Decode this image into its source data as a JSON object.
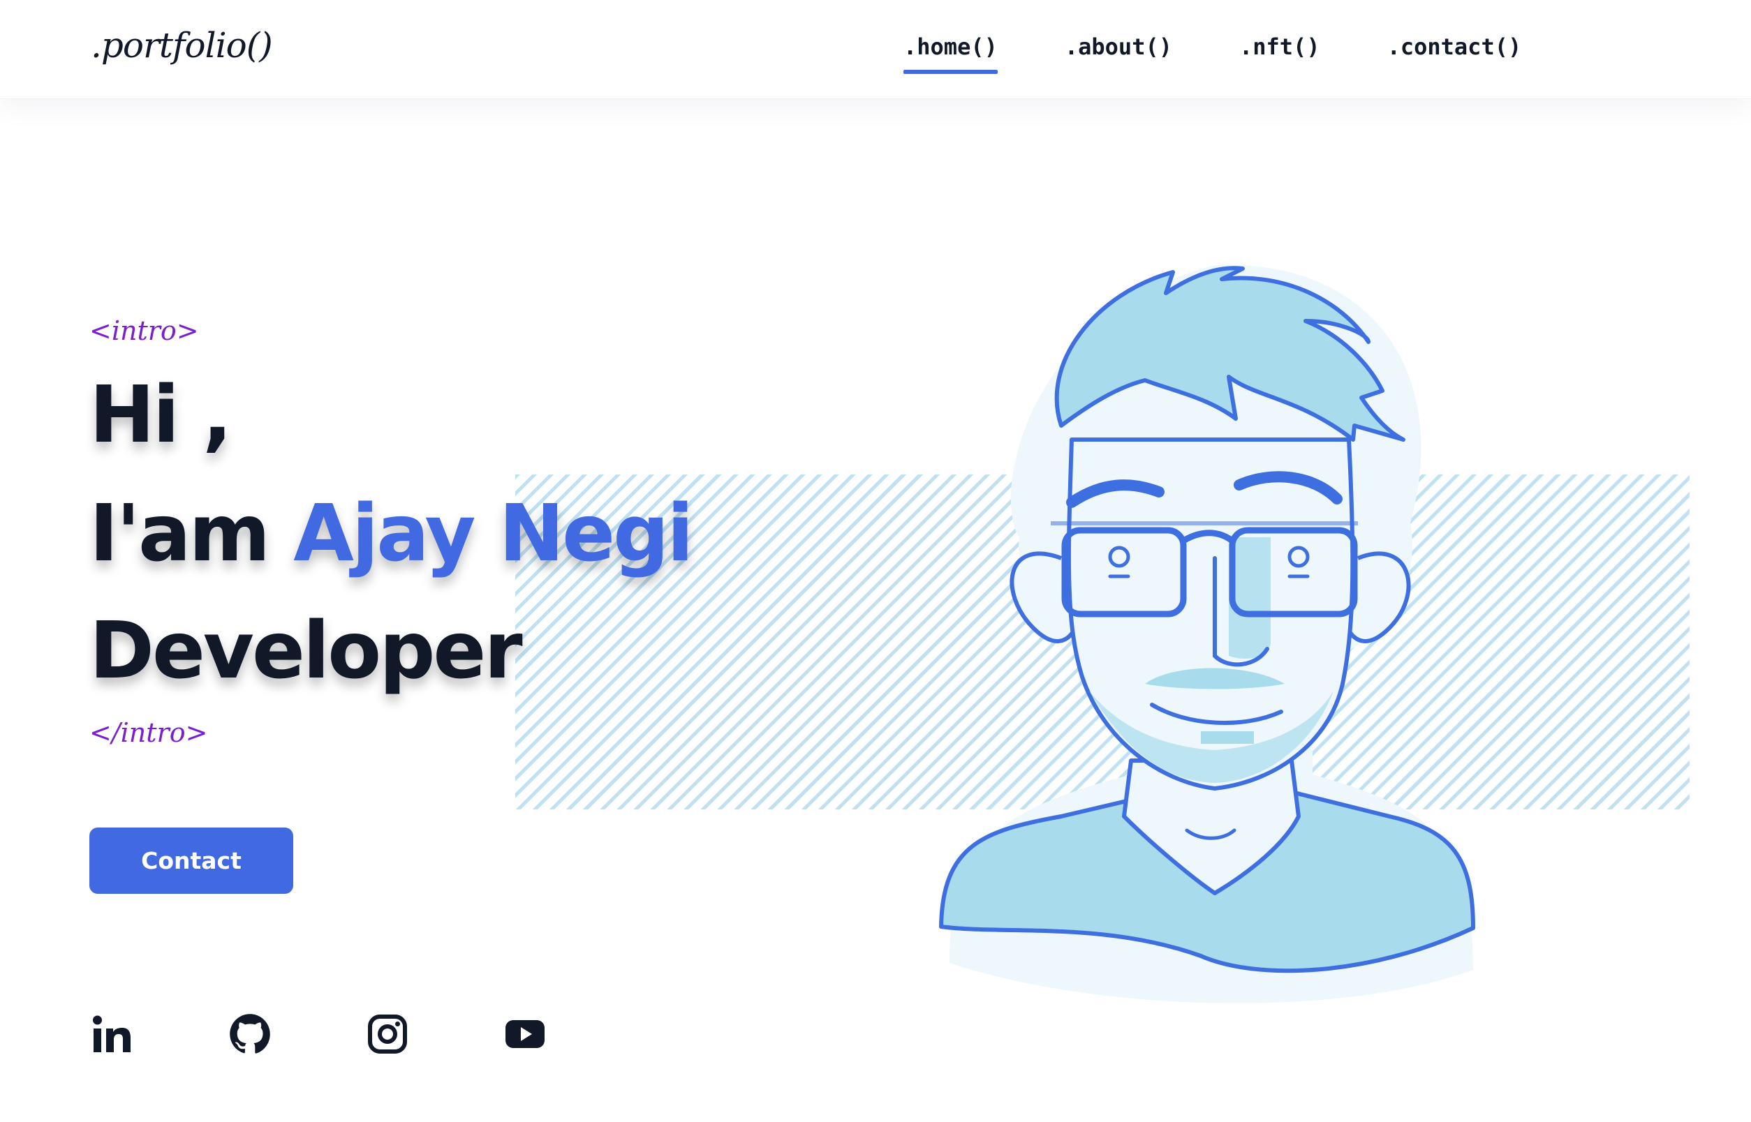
{
  "nav": {
    "logo": ".portfolio()",
    "items": [
      {
        "label": ".home()",
        "active": true
      },
      {
        "label": ".about()",
        "active": false
      },
      {
        "label": ".nft()",
        "active": false
      },
      {
        "label": ".contact()",
        "active": false
      }
    ]
  },
  "hero": {
    "intro_open": "<intro>",
    "line1": "Hi ,",
    "line2_prefix": "I'am ",
    "name": "Ajay Negi",
    "line3": "Developer",
    "intro_close": "</intro>",
    "contact_label": "Contact"
  },
  "social": {
    "icons": [
      "linkedin-icon",
      "github-icon",
      "instagram-icon",
      "youtube-icon"
    ]
  },
  "colors": {
    "accent": "#4169e1",
    "tag": "#7a1fd0",
    "text": "#111827",
    "avatar_fill": "#a8dbec",
    "avatar_stroke": "#3e6fe0"
  }
}
